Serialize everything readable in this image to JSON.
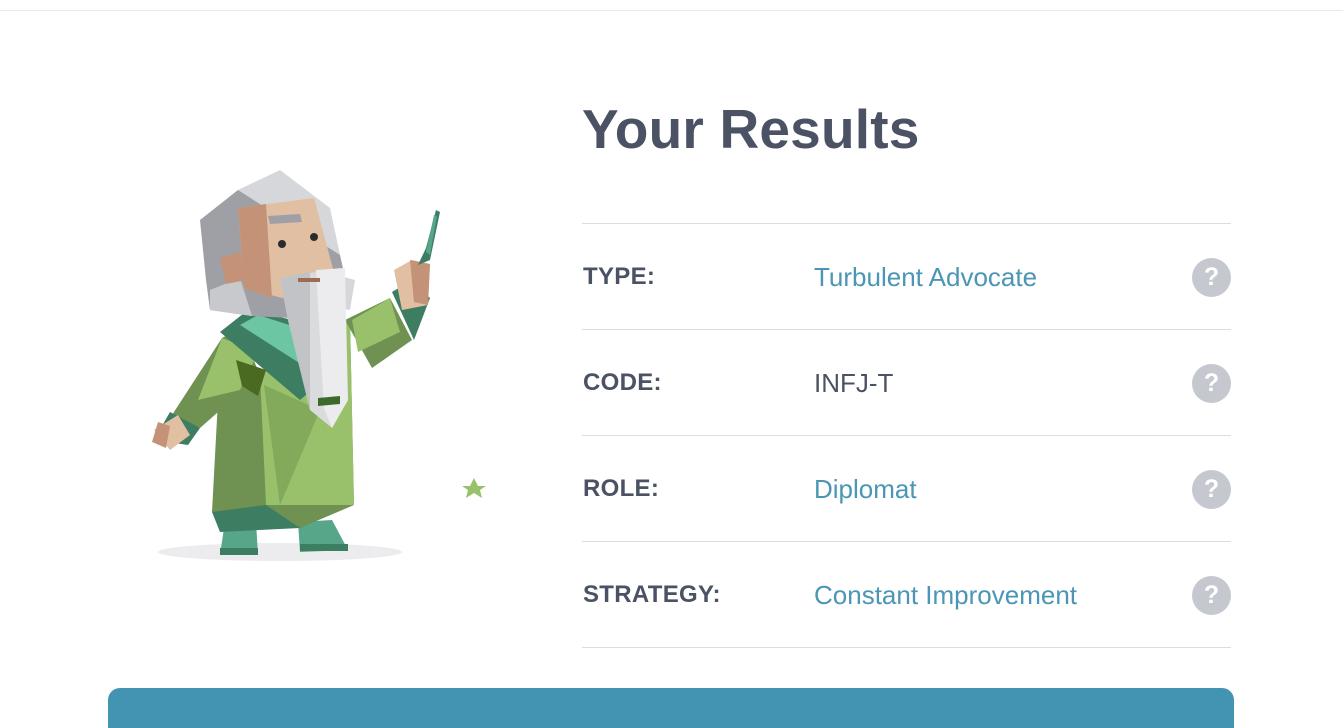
{
  "page": {
    "title": "Your Results"
  },
  "results": [
    {
      "label": "TYPE:",
      "value": "Turbulent Advocate",
      "value_color": "#4a96b4",
      "help": "?"
    },
    {
      "label": "CODE:",
      "value": "INFJ-T",
      "value_color": "#4a5264",
      "help": "?"
    },
    {
      "label": "ROLE:",
      "value": "Diplomat",
      "value_color": "#4a96b4",
      "help": "?"
    },
    {
      "label": "STRATEGY:",
      "value": "Constant Improvement",
      "value_color": "#4a96b4",
      "help": "?"
    }
  ],
  "colors": {
    "heading": "#4a5264",
    "link": "#4a96b4",
    "help_icon_bg": "#c5c8cf",
    "banner": "#4394b2"
  },
  "illustration": {
    "icon": "advocate-wizard-illustration"
  }
}
